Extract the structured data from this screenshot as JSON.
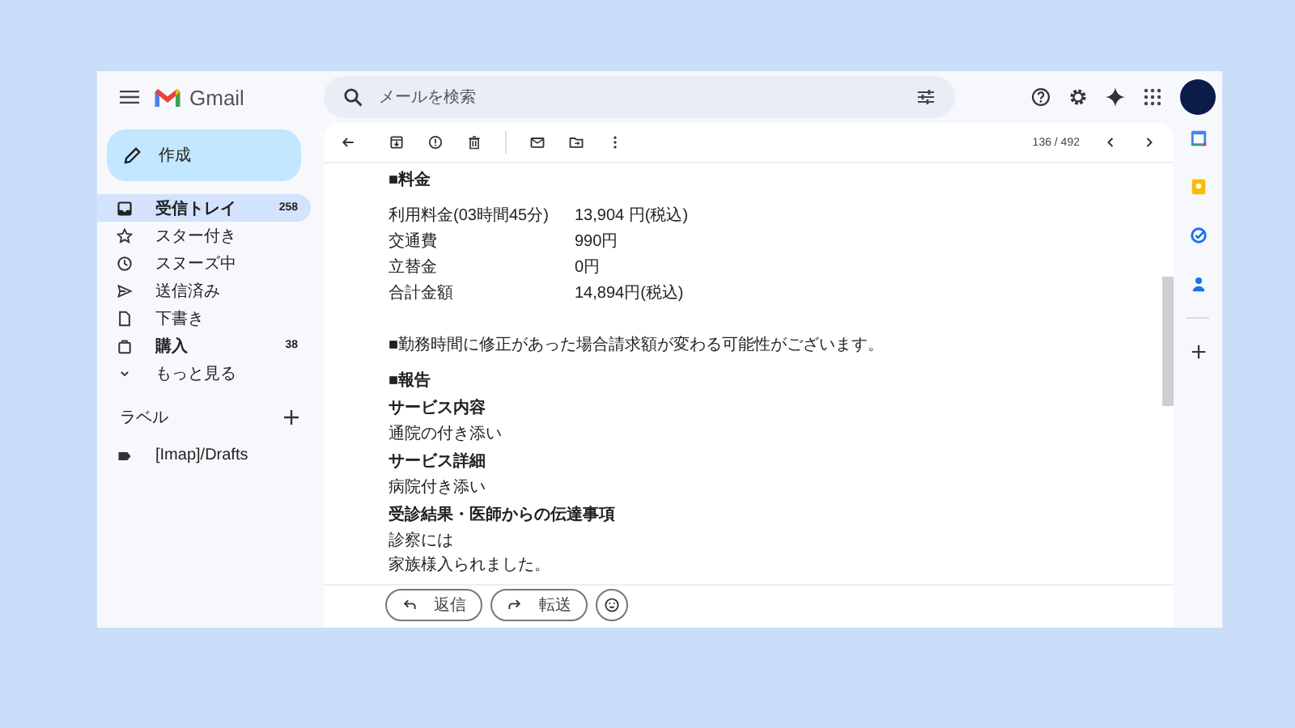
{
  "header": {
    "logo": "Gmail",
    "search": {
      "placeholder": "メールを検索"
    }
  },
  "compose": {
    "label": "作成"
  },
  "nav": [
    {
      "kind": "inbox",
      "label": "受信トレイ",
      "count": "258",
      "selected": true,
      "unread": true
    },
    {
      "kind": "star",
      "label": "スター付き",
      "selected": false,
      "unread": false
    },
    {
      "kind": "snooze",
      "label": "スヌーズ中",
      "selected": false,
      "unread": false
    },
    {
      "kind": "sent",
      "label": "送信済み",
      "selected": false,
      "unread": false
    },
    {
      "kind": "draft",
      "label": "下書き",
      "selected": false,
      "unread": false
    },
    {
      "kind": "purchase",
      "label": "購入",
      "count": "38",
      "selected": false,
      "unread": true
    },
    {
      "kind": "more",
      "label": "もっと見る",
      "selected": false,
      "unread": false
    }
  ],
  "labels": {
    "title": "ラベル",
    "items": [
      {
        "label": "[Imap]/Drafts"
      }
    ]
  },
  "toolbar": {
    "pager": "136 / 492"
  },
  "message": {
    "fee_heading": "■料金",
    "fees": [
      {
        "item": "利用料金(03時間45分)",
        "amount": "13,904 円(税込)"
      },
      {
        "item": "交通費",
        "amount": "990円"
      },
      {
        "item": "立替金",
        "amount": "0円"
      },
      {
        "item": "合計金額",
        "amount": "14,894円(税込)"
      }
    ],
    "note": "■勤務時間に修正があった場合請求額が変わる可能性がございます。",
    "report_heading": "■報告",
    "report": [
      {
        "kind": "heading",
        "text": "サービス内容"
      },
      {
        "kind": "text",
        "text": "通院の付き添い"
      },
      {
        "kind": "heading",
        "text": "サービス詳細"
      },
      {
        "kind": "text",
        "text": "病院付き添い"
      },
      {
        "kind": "heading",
        "text": "受診結果・医師からの伝達事項"
      },
      {
        "kind": "text",
        "text": "診察には"
      },
      {
        "kind": "text",
        "text": "家族様入られました。"
      }
    ]
  },
  "reply_bar": {
    "reply": "返信",
    "forward": "転送"
  }
}
